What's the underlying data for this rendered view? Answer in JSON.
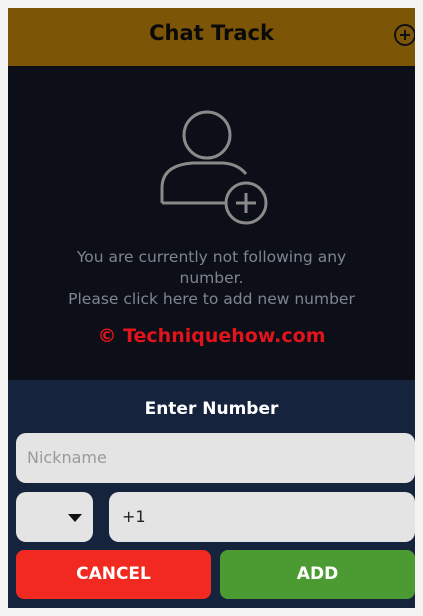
{
  "header": {
    "title": "Chat Track",
    "add_icon": "plus-circle-icon"
  },
  "empty_state": {
    "icon": "user-add-icon",
    "line1": "You are currently not following any",
    "line2": "number.",
    "line3": "Please click here to add new number"
  },
  "watermark": "© Techniquehow.com",
  "dialog": {
    "title": "Enter Number",
    "nickname_placeholder": "Nickname",
    "country_code_selected": "",
    "phone_value": "+1",
    "cancel_label": "CANCEL",
    "add_label": "ADD"
  },
  "colors": {
    "header_bg": "#7d5507",
    "screen_bg": "#0c0f17",
    "dialog_bg": "#16233d",
    "cancel_bg": "#f12920",
    "add_bg": "#4c9a32",
    "watermark": "#e0141a"
  }
}
